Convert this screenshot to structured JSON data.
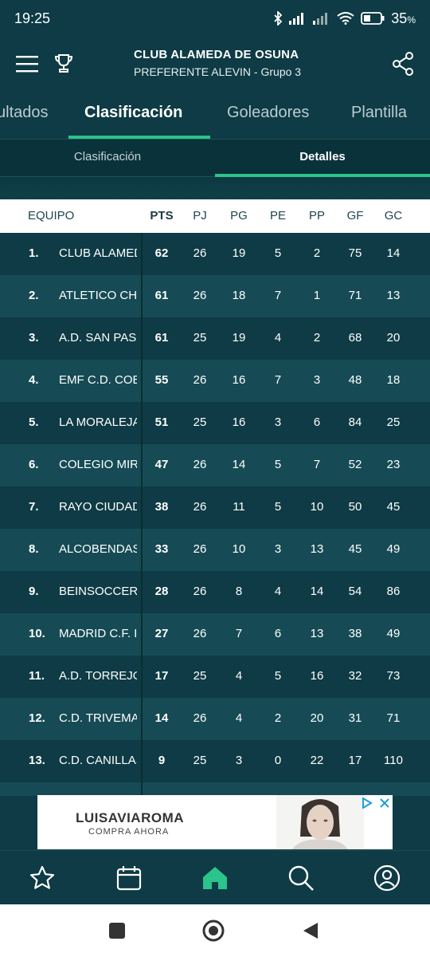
{
  "status_bar": {
    "time": "19:25",
    "battery": "35",
    "battery_unit": "%",
    "icons": [
      "bluetooth-icon",
      "signal-icon",
      "signal-weak-icon",
      "wifi-icon",
      "battery-icon"
    ]
  },
  "header": {
    "title": "CLUB ALAMEDA DE OSUNA",
    "subtitle": "PREFERENTE ALEVIN - Grupo 3",
    "icons": [
      "menu-icon",
      "trophy-icon",
      "share-icon"
    ]
  },
  "tabs": [
    "ultados",
    "Clasificación",
    "Goleadores",
    "Plantilla"
  ],
  "active_tab": "Clasificación",
  "subtabs": [
    "Clasificación",
    "Detalles"
  ],
  "active_subtab": "Detalles",
  "table": {
    "headers": [
      "EQUIPO",
      "PTS",
      "PJ",
      "PG",
      "PE",
      "PP",
      "GF",
      "GC"
    ],
    "rows": [
      {
        "pos": "1.",
        "team": "CLUB ALAMEDA",
        "pts": "62",
        "pj": "26",
        "pg": "19",
        "pe": "5",
        "pp": "2",
        "gf": "75",
        "gc": "14"
      },
      {
        "pos": "2.",
        "team": "ATLETICO CHAMARTIN",
        "pts": "61",
        "pj": "26",
        "pg": "18",
        "pe": "7",
        "pp": "1",
        "gf": "71",
        "gc": "13"
      },
      {
        "pos": "3.",
        "team": "A.D. SAN PASCUAL",
        "pts": "61",
        "pj": "25",
        "pg": "19",
        "pe": "4",
        "pp": "2",
        "gf": "68",
        "gc": "20"
      },
      {
        "pos": "4.",
        "team": "EMF C.D. COBEÑA",
        "pts": "55",
        "pj": "26",
        "pg": "16",
        "pe": "7",
        "pp": "3",
        "gf": "48",
        "gc": "18"
      },
      {
        "pos": "5.",
        "team": "LA MORALEJA",
        "pts": "51",
        "pj": "25",
        "pg": "16",
        "pe": "3",
        "pp": "6",
        "gf": "84",
        "gc": "25"
      },
      {
        "pos": "6.",
        "team": "COLEGIO MIRABAL",
        "pts": "47",
        "pj": "26",
        "pg": "14",
        "pe": "5",
        "pp": "7",
        "gf": "52",
        "gc": "23"
      },
      {
        "pos": "7.",
        "team": "RAYO CIUDAD ALCOBENDAS",
        "pts": "38",
        "pj": "26",
        "pg": "11",
        "pe": "5",
        "pp": "10",
        "gf": "50",
        "gc": "45"
      },
      {
        "pos": "8.",
        "team": "ALCOBENDAS SPORT",
        "pts": "33",
        "pj": "26",
        "pg": "10",
        "pe": "3",
        "pp": "13",
        "gf": "45",
        "gc": "49"
      },
      {
        "pos": "9.",
        "team": "BEINSOCCER",
        "pts": "28",
        "pj": "26",
        "pg": "8",
        "pe": "4",
        "pp": "14",
        "gf": "54",
        "gc": "86"
      },
      {
        "pos": "10.",
        "team": "MADRID C.F. INTERNACIONAL",
        "pts": "27",
        "pj": "26",
        "pg": "7",
        "pe": "6",
        "pp": "13",
        "gf": "38",
        "gc": "49"
      },
      {
        "pos": "11.",
        "team": "A.D. TORREJON",
        "pts": "17",
        "pj": "25",
        "pg": "4",
        "pe": "5",
        "pp": "16",
        "gf": "32",
        "gc": "73"
      },
      {
        "pos": "12.",
        "team": "C.D. TRIVEMAR",
        "pts": "14",
        "pj": "26",
        "pg": "4",
        "pe": "2",
        "pp": "20",
        "gf": "31",
        "gc": "71"
      },
      {
        "pos": "13.",
        "team": "C.D. CANILLAS",
        "pts": "9",
        "pj": "25",
        "pg": "3",
        "pe": "0",
        "pp": "22",
        "gf": "17",
        "gc": "110"
      }
    ]
  },
  "ad": {
    "brand": "LUISAVIAROMA",
    "cta": "COMPRA AHORA",
    "choices_icons": [
      "adchoices-icon",
      "close-icon"
    ]
  },
  "bottom_nav": {
    "items": [
      "star-icon",
      "calendar-icon",
      "home-icon",
      "search-icon",
      "profile-icon"
    ],
    "active": "home-icon"
  },
  "colors": {
    "background": "#0e3b45",
    "row_alt": "#164b55",
    "accent": "#2bc48a",
    "header_bg": "#ffffff"
  }
}
